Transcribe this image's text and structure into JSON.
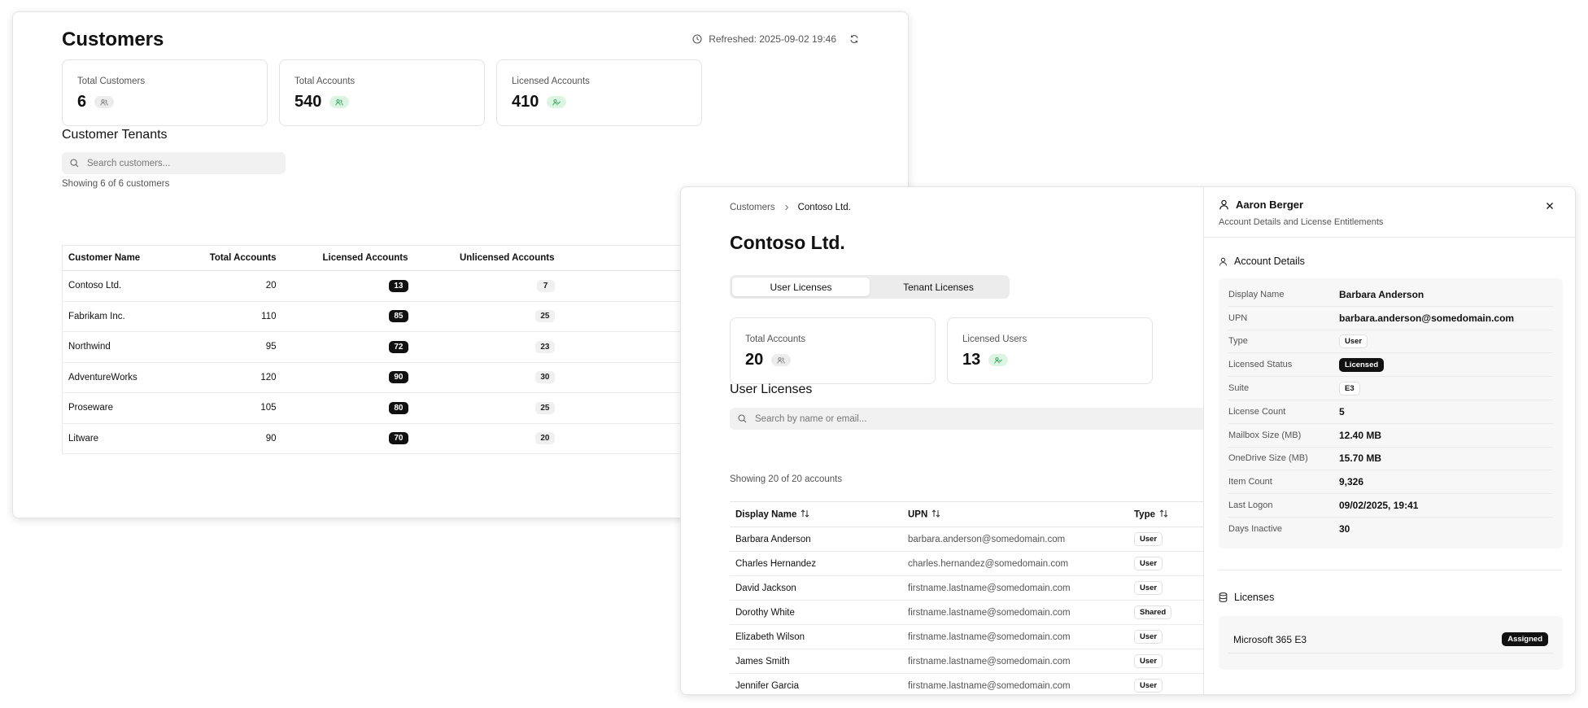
{
  "customers_page": {
    "title": "Customers",
    "refreshed": "Refreshed: 2025-09-02 19:46",
    "stats": [
      {
        "label": "Total Customers",
        "value": "6"
      },
      {
        "label": "Total Accounts",
        "value": "540"
      },
      {
        "label": "Licensed Accounts",
        "value": "410"
      }
    ],
    "section_title": "Customer Tenants",
    "search_placeholder": "Search customers...",
    "showing": "Showing 6 of 6 customers",
    "columns": [
      "Customer Name",
      "Total Accounts",
      "Licensed Accounts",
      "Unlicensed Accounts"
    ],
    "rows": [
      {
        "name": "Contoso Ltd.",
        "total": "20",
        "licensed": "13",
        "unlicensed": "7"
      },
      {
        "name": "Fabrikam Inc.",
        "total": "110",
        "licensed": "85",
        "unlicensed": "25"
      },
      {
        "name": "Northwind",
        "total": "95",
        "licensed": "72",
        "unlicensed": "23"
      },
      {
        "name": "AdventureWorks",
        "total": "120",
        "licensed": "90",
        "unlicensed": "30"
      },
      {
        "name": "Proseware",
        "total": "105",
        "licensed": "80",
        "unlicensed": "25"
      },
      {
        "name": "Litware",
        "total": "90",
        "licensed": "70",
        "unlicensed": "20"
      }
    ]
  },
  "tenant_page": {
    "breadcrumb": {
      "parent": "Customers",
      "current": "Contoso Ltd."
    },
    "title": "Contoso Ltd.",
    "tabs": [
      "User Licenses",
      "Tenant Licenses"
    ],
    "stats": [
      {
        "label": "Total Accounts",
        "value": "20"
      },
      {
        "label": "Licensed Users",
        "value": "13"
      }
    ],
    "section_title": "User Licenses",
    "search_placeholder": "Search by name or email...",
    "showing": "Showing 20 of 20 accounts",
    "columns": [
      "Display Name",
      "UPN",
      "Type"
    ],
    "rows": [
      {
        "name": "Barbara Anderson",
        "upn": "barbara.anderson@somedomain.com",
        "type": "User"
      },
      {
        "name": "Charles Hernandez",
        "upn": "charles.hernandez@somedomain.com",
        "type": "User"
      },
      {
        "name": "David Jackson",
        "upn": "firstname.lastname@somedomain.com",
        "type": "User"
      },
      {
        "name": "Dorothy White",
        "upn": "firstname.lastname@somedomain.com",
        "type": "Shared"
      },
      {
        "name": "Elizabeth Wilson",
        "upn": "firstname.lastname@somedomain.com",
        "type": "User"
      },
      {
        "name": "James Smith",
        "upn": "firstname.lastname@somedomain.com",
        "type": "User"
      },
      {
        "name": "Jennifer Garcia",
        "upn": "firstname.lastname@somedomain.com",
        "type": "User"
      }
    ]
  },
  "detail_panel": {
    "title": "Aaron Berger",
    "subtitle": "Account Details and License Entitlements",
    "account_section": "Account Details",
    "details": [
      {
        "key": "Display Name",
        "value": "Barbara Anderson"
      },
      {
        "key": "UPN",
        "value": "barbara.anderson@somedomain.com"
      },
      {
        "key": "Type",
        "value": "User"
      },
      {
        "key": "Licensed Status",
        "value": "Licensed"
      },
      {
        "key": "Suite",
        "value": "E3"
      },
      {
        "key": "License Count",
        "value": "5"
      },
      {
        "key": "Mailbox Size (MB)",
        "value": "12.40 MB"
      },
      {
        "key": "OneDrive Size (MB)",
        "value": "15.70 MB"
      },
      {
        "key": "Item Count",
        "value": "9,326"
      },
      {
        "key": "Last Logon",
        "value": "09/02/2025, 19:41"
      },
      {
        "key": "Days Inactive",
        "value": "30"
      }
    ],
    "licenses_section": "Licenses",
    "licenses": [
      {
        "name": "Microsoft 365 E3",
        "status": "Assigned"
      }
    ]
  },
  "colors": {
    "accent_dark": "#111111",
    "chip_green": "#dcf5e3",
    "chip_gray": "#ececec"
  }
}
